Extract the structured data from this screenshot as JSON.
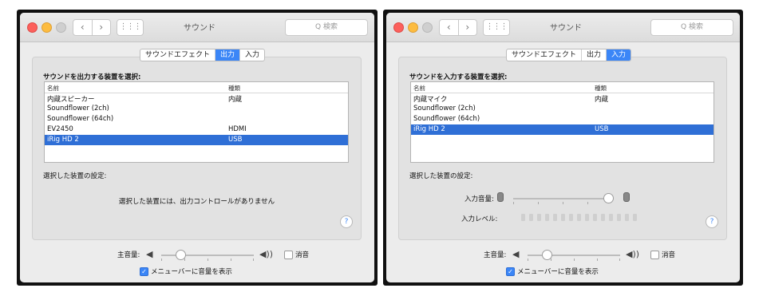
{
  "windows": [
    {
      "title": "サウンド",
      "search_placeholder": "Q 検索",
      "tabs": [
        {
          "label": "サウンドエフェクト",
          "active": false
        },
        {
          "label": "出力",
          "active": true
        },
        {
          "label": "入力",
          "active": false
        }
      ],
      "heading": "サウンドを出力する装置を選択:",
      "columns": [
        "名前",
        "種類"
      ],
      "rows": [
        {
          "name": "内蔵スピーカー",
          "type": "内蔵"
        },
        {
          "name": "Soundflower (2ch)",
          "type": ""
        },
        {
          "name": "Soundflower (64ch)",
          "type": ""
        },
        {
          "name": "EV2450",
          "type": "HDMI"
        },
        {
          "name": "iRig HD 2",
          "type": "USB",
          "selected": true
        }
      ],
      "settings_label": "選択した装置の設定:",
      "no_controls_text": "選択した装置には、出力コントロールがありません",
      "help": "?",
      "volume_label": "主音量:",
      "volume_level": 0.15,
      "mute_label": "消音",
      "menubar_label": "メニューバーに音量を表示"
    },
    {
      "title": "サウンド",
      "search_placeholder": "Q 検索",
      "tabs": [
        {
          "label": "サウンドエフェクト",
          "active": false
        },
        {
          "label": "出力",
          "active": false
        },
        {
          "label": "入力",
          "active": true
        }
      ],
      "heading": "サウンドを入力する装置を選択:",
      "columns": [
        "名前",
        "種類"
      ],
      "rows": [
        {
          "name": "内蔵マイク",
          "type": "内蔵"
        },
        {
          "name": "Soundflower (2ch)",
          "type": ""
        },
        {
          "name": "Soundflower (64ch)",
          "type": ""
        },
        {
          "name": "iRig HD 2",
          "type": "USB",
          "selected": true
        }
      ],
      "settings_label": "選択した装置の設定:",
      "input_volume_label": "入力音量:",
      "input_volume_level": 1.0,
      "input_level_label": "入力レベル:",
      "help": "?",
      "volume_label": "主音量:",
      "volume_level": 0.15,
      "mute_label": "消音",
      "menubar_label": "メニューバーに音量を表示"
    }
  ]
}
